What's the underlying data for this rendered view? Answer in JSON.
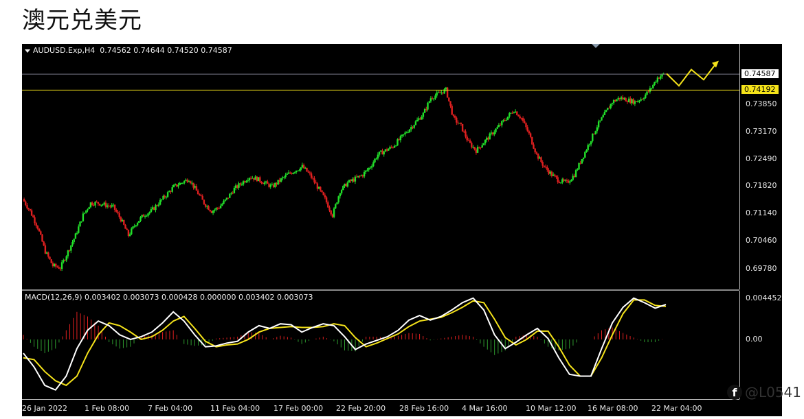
{
  "page_title": "澳元兑美元",
  "watermark": "@L0541",
  "chart_data": [
    {
      "type": "candlestick",
      "symbol": "AUDUSD.Exp,H4",
      "ohlc": [
        "0.74562",
        "0.74644",
        "0.74520",
        "0.74587"
      ],
      "ylim": [
        0.694,
        0.752
      ],
      "y_ticks": [
        "0.74587",
        "0.74192",
        "0.73850",
        "0.73170",
        "0.72490",
        "0.71820",
        "0.71140",
        "0.70460",
        "0.69780"
      ],
      "current_price": 0.74587,
      "current_price_label": "0.74587",
      "horizontal_line": 0.74192,
      "horizontal_line_label": "0.74192",
      "x_ticks": [
        "26 Jan 2022",
        "1 Feb 08:00",
        "7 Feb 04:00",
        "11 Feb 04:00",
        "17 Feb 00:00",
        "22 Feb 20:00",
        "28 Feb 16:00",
        "4 Mar 16:00",
        "10 Mar 12:00",
        "16 Mar 08:00",
        "22 Mar 04:00"
      ],
      "close_path": [
        0.715,
        0.712,
        0.708,
        0.702,
        0.6985,
        0.698,
        0.702,
        0.706,
        0.711,
        0.714,
        0.714,
        0.7135,
        0.713,
        0.71,
        0.706,
        0.709,
        0.711,
        0.712,
        0.714,
        0.716,
        0.718,
        0.719,
        0.72,
        0.717,
        0.714,
        0.712,
        0.713,
        0.715,
        0.7175,
        0.719,
        0.7205,
        0.72,
        0.719,
        0.718,
        0.7195,
        0.721,
        0.722,
        0.723,
        0.721,
        0.718,
        0.715,
        0.711,
        0.717,
        0.719,
        0.72,
        0.721,
        0.723,
        0.726,
        0.727,
        0.728,
        0.73,
        0.732,
        0.734,
        0.736,
        0.74,
        0.741,
        0.742,
        0.735,
        0.733,
        0.729,
        0.727,
        0.729,
        0.731,
        0.733,
        0.735,
        0.737,
        0.735,
        0.731,
        0.726,
        0.723,
        0.721,
        0.7195,
        0.719,
        0.721,
        0.725,
        0.729,
        0.733,
        0.736,
        0.739,
        0.74,
        0.7395,
        0.739,
        0.74,
        0.742,
        0.745,
        0.746
      ],
      "forecast_arrow": [
        0.746,
        0.743,
        0.747,
        0.7445,
        0.7485
      ],
      "forecast_arrow_color": "#f5e31a",
      "up_color": "#22e02a",
      "down_color": "#e02020",
      "horizontal_line_color": "#f5e31a"
    },
    {
      "type": "line+bar",
      "label": "MACD(12,26,9) 0.003402 0.003073 0.000428 0.000000 0.003402 0.003073",
      "ylim": [
        -0.0062,
        0.005
      ],
      "y_ticks": [
        "0.004452",
        "0.00"
      ],
      "macd_line": [
        -0.0015,
        -0.003,
        -0.005,
        -0.0055,
        -0.004,
        -0.001,
        0.001,
        0.002,
        0.0015,
        0.0005,
        0.0,
        0.0003,
        0.0008,
        0.0018,
        0.003,
        0.002,
        0.0005,
        -0.0008,
        -0.0007,
        -0.0004,
        -0.0002,
        0.0008,
        0.0015,
        0.0012,
        0.0017,
        0.0016,
        0.0008,
        0.0013,
        0.0017,
        0.0015,
        0.0003,
        -0.0011,
        -0.0005,
        -0.0001,
        0.0003,
        0.001,
        0.0021,
        0.0026,
        0.0021,
        0.0025,
        0.0032,
        0.004,
        0.0045,
        0.0032,
        0.0005,
        -0.001,
        -0.0003,
        0.0005,
        0.0012,
        0.0001,
        -0.002,
        -0.0038,
        -0.004,
        -0.004,
        -0.001,
        0.0018,
        0.0035,
        0.0045,
        0.004,
        0.0034,
        0.0038
      ],
      "signal_line": [
        -0.002,
        -0.0022,
        -0.0035,
        -0.0045,
        -0.005,
        -0.004,
        -0.0015,
        0.0005,
        0.0018,
        0.0015,
        0.0008,
        0.0,
        0.0003,
        0.001,
        0.002,
        0.0025,
        0.0012,
        -0.0002,
        -0.0008,
        -0.0006,
        -0.0005,
        0.0,
        0.0008,
        0.0012,
        0.0013,
        0.0014,
        0.0013,
        0.0013,
        0.0014,
        0.0017,
        0.0015,
        0.0002,
        -0.0008,
        -0.0004,
        0.0001,
        0.0006,
        0.0014,
        0.002,
        0.0022,
        0.0024,
        0.0029,
        0.0035,
        0.0042,
        0.004,
        0.0022,
        0.0002,
        -0.0006,
        0.0,
        0.0009,
        0.0009,
        -0.0008,
        -0.0028,
        -0.004,
        -0.004,
        -0.002,
        0.0005,
        0.0028,
        0.0043,
        0.0043,
        0.0037,
        0.0036
      ],
      "histogram": [
        0.0005,
        -0.0008,
        -0.0015,
        -0.001,
        0.001,
        0.003,
        0.0025,
        0.0015,
        -0.0003,
        -0.001,
        -0.0008,
        0.0003,
        0.0005,
        0.0008,
        0.001,
        -0.0005,
        -0.0007,
        -0.0006,
        0.0001,
        0.0002,
        0.0003,
        0.0008,
        0.0007,
        0.0,
        0.0004,
        0.0002,
        -0.0005,
        0.0,
        0.0003,
        -0.0002,
        -0.0012,
        -0.0013,
        0.0003,
        0.0003,
        0.0002,
        0.0004,
        0.0007,
        0.0006,
        -0.0001,
        0.0001,
        0.0003,
        0.0005,
        0.0003,
        -0.0008,
        -0.0017,
        -0.0012,
        0.0003,
        0.0005,
        0.0003,
        -0.0008,
        -0.0012,
        -0.001,
        0.0,
        0.0,
        0.001,
        0.0013,
        0.0007,
        0.0002,
        -0.0003,
        -0.0003,
        0.0002
      ],
      "macd_color": "#ffffff",
      "signal_color": "#f5e31a",
      "hist_up_color": "#e02020",
      "hist_down_color": "#2e9a2e"
    }
  ]
}
